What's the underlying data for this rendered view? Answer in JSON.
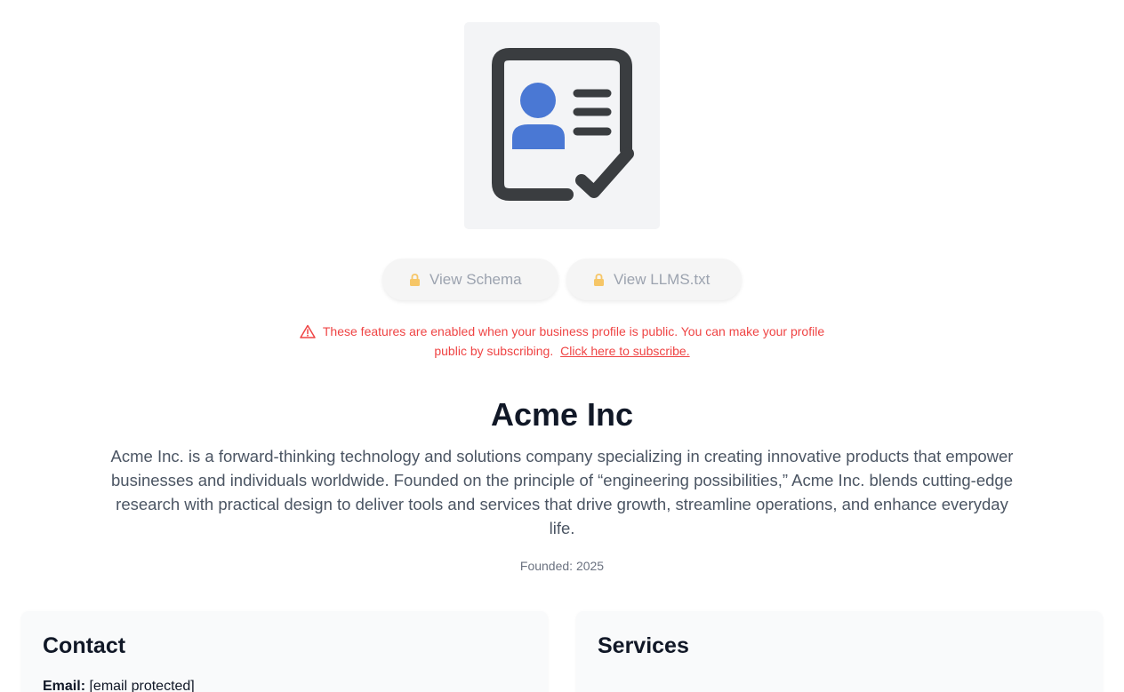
{
  "logo": {
    "icon": "contact-card-check-icon",
    "colors": {
      "outline": "#3a3d40",
      "person": "#4a78d4",
      "background": "#f3f4f6"
    }
  },
  "actions": {
    "view_schema": "View Schema",
    "view_llms": "View LLMS.txt",
    "lock_icon": "lock-icon",
    "lock_color": "#f6c667"
  },
  "notice": {
    "text": "These features are enabled when your business profile is public. You can make your profile public by subscribing.",
    "link": "Click here to subscribe.",
    "color": "#ef4444"
  },
  "business": {
    "name": "Acme Inc",
    "description": "Acme Inc. is a forward-thinking technology and solutions company specializing in creating innovative products that empower businesses and individuals worldwide. Founded on the principle of “engineering possibilities,” Acme Inc. blends cutting-edge research with practical design to deliver tools and services that drive growth, streamline operations, and enhance everyday life.",
    "founded": "Founded: 2025"
  },
  "contact": {
    "heading": "Contact",
    "email_label": "Email:",
    "email_value": "[email protected]"
  },
  "services": {
    "heading": "Services"
  }
}
